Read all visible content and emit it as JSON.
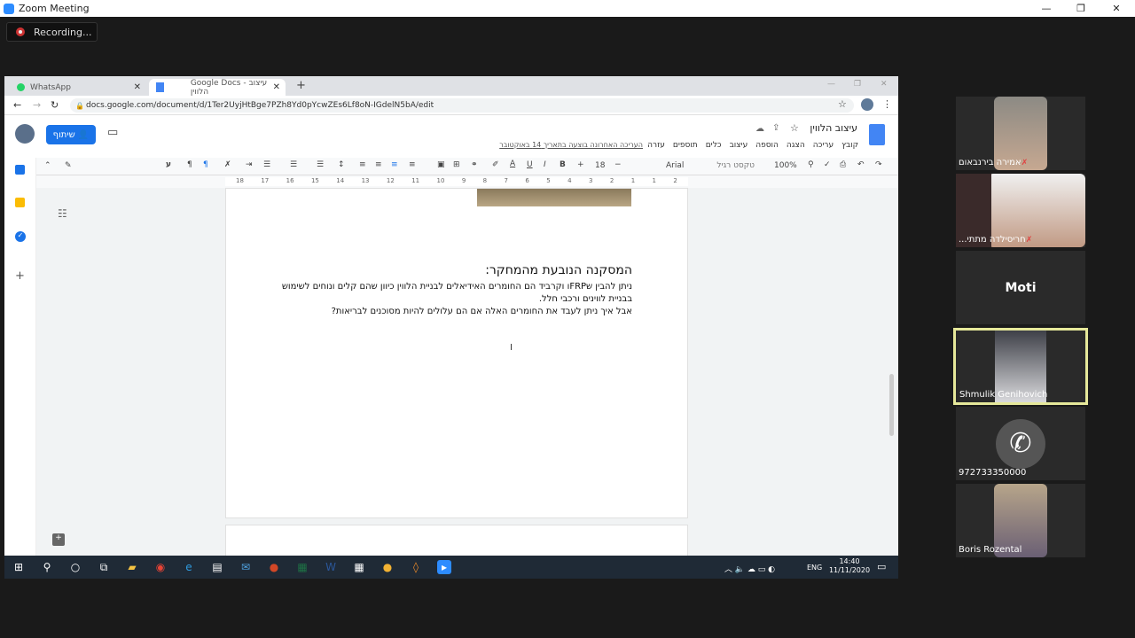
{
  "window": {
    "title": "Zoom Meeting",
    "recording": "Recording..."
  },
  "browser": {
    "tabs": [
      {
        "label": "WhatsApp"
      },
      {
        "label": "Google Docs - עיצוב הלווין"
      }
    ],
    "url": "docs.google.com/document/d/1Ter2UyjHtBge7PZh8Yd0pYcwZEs6Lf8oN-IGdelN5bA/edit",
    "new_tab": "+"
  },
  "docs": {
    "title": "עיצוב הלווין",
    "share_label": "שיתוף",
    "menu": [
      "קובץ",
      "עריכה",
      "הצגה",
      "הוספה",
      "עיצוב",
      "כלים",
      "תוספים",
      "עזרה"
    ],
    "last_edit": "העריכה האחרונה בוצעה בתאריך 14 באוקטובר",
    "toolbar": {
      "zoom": "100%",
      "style": "טקסט רגיל",
      "font": "Arial",
      "size": "18"
    },
    "ruler": [
      "18",
      "17",
      "16",
      "15",
      "14",
      "13",
      "12",
      "11",
      "10",
      "9",
      "8",
      "7",
      "6",
      "5",
      "4",
      "3",
      "2",
      "1",
      "1",
      "2"
    ],
    "content": {
      "heading": "המסקנה הנובעת מהמחקר:",
      "p1": "ניתן להבין שFRPו וקרביד הם החומרים האידיאלים לבניית הלווין כיוון שהם קלים ונוחים לשימוש",
      "p2": "בבניית לווינים ורכבי חלל.",
      "p3": "אבל איך ניתן לעבד את החומרים האלה אם הם עלולים להיות מסוכנים לבריאות?"
    }
  },
  "taskbar": {
    "lang": "ENG",
    "time": "14:40",
    "date": "11/11/2020"
  },
  "participants": [
    {
      "name": "אמירה בירנבאום",
      "muted": true
    },
    {
      "name": "חריסילדה מתתי...",
      "muted": true
    },
    {
      "name": "Moti",
      "muted": false
    },
    {
      "name": "Shmulik Genihovich",
      "muted": false,
      "active": true
    },
    {
      "name": "972733350000",
      "muted": false
    },
    {
      "name": "Boris Rozental",
      "muted": false
    }
  ],
  "colors": {
    "accent": "#1a73e8",
    "active_speaker": "#e6e89a",
    "zoom_blue": "#2d8cff"
  }
}
